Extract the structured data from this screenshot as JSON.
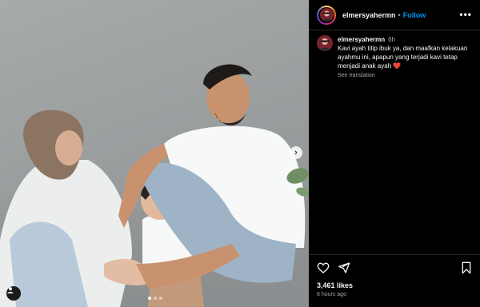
{
  "post": {
    "next_icon": "chevron-right-icon",
    "tagged_icon": "person-icon",
    "carousel": {
      "count": 3,
      "active_index": 0
    }
  },
  "header": {
    "username": "elmersyahermn",
    "separator": "•",
    "follow_label": "Follow",
    "more_icon": "more-horizontal-icon",
    "more_label": "•••"
  },
  "caption": {
    "username": "elmersyahermn",
    "time": "6h",
    "text": "Kavi ayah titip ibuk ya, dan maafkan kelakuan ayahmu ini, apapun yang terjadi kavi tetap menjadi anak ayah",
    "emoji": "❤️",
    "see_translation": "See translation"
  },
  "actions": {
    "like_icon": "heart-icon",
    "share_icon": "share-icon",
    "save_icon": "bookmark-icon",
    "likes": "3,461 likes",
    "time_ago": "6 hours ago"
  },
  "colors": {
    "accent": "#0095f6",
    "background": "#000000",
    "divider": "#262626",
    "secondary_text": "#a8a8a8"
  }
}
